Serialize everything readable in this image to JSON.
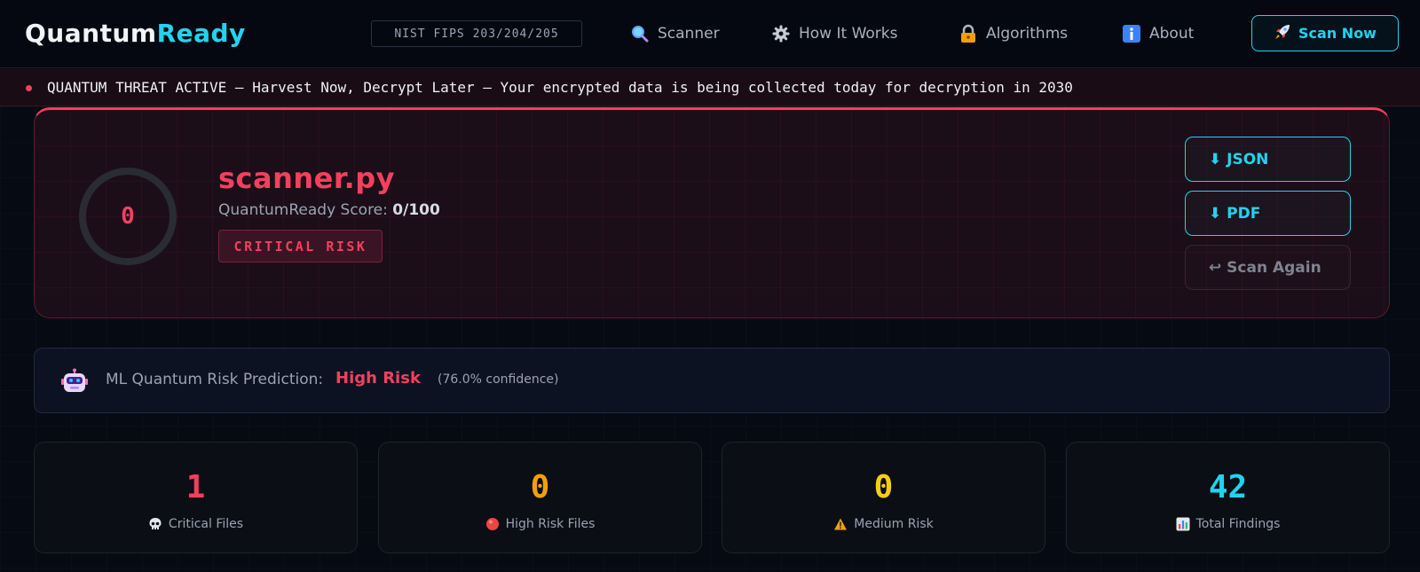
{
  "header": {
    "logo_part1": "Quantum",
    "logo_part2": "Ready",
    "badge": "NIST FIPS 203/204/205",
    "nav": [
      {
        "label": "Scanner",
        "icon": "magnifier-icon"
      },
      {
        "label": "How It Works",
        "icon": "gear-icon"
      },
      {
        "label": "Algorithms",
        "icon": "lock-icon"
      },
      {
        "label": "About",
        "icon": "info-icon"
      }
    ],
    "cta_label": "Scan Now",
    "cta_icon": "rocket-icon"
  },
  "alert": {
    "text": "QUANTUM THREAT ACTIVE — Harvest Now, Decrypt Later — Your encrypted data is being collected today for decryption in 2030"
  },
  "result": {
    "score": "0",
    "file_name": "scanner.py",
    "score_prefix": "QuantumReady Score: ",
    "score_text": "0/100",
    "risk_level": "CRITICAL RISK",
    "actions": {
      "json": "⬇ JSON",
      "pdf": "⬇ PDF",
      "scan_again": "↩ Scan Again"
    }
  },
  "ml": {
    "label": "ML Quantum Risk Prediction:",
    "prediction": "High Risk",
    "confidence": "(76.0% confidence)"
  },
  "stats": [
    {
      "value": "1",
      "label": "Critical Files",
      "icon": "skull-icon",
      "color": "#f43f5e"
    },
    {
      "value": "0",
      "label": "High Risk Files",
      "icon": "red-circle-icon",
      "color": "#f59e0b"
    },
    {
      "value": "0",
      "label": "Medium Risk",
      "icon": "warning-icon",
      "color": "#facc15"
    },
    {
      "value": "42",
      "label": "Total Findings",
      "icon": "bar-chart-icon",
      "color": "#22d3ee"
    }
  ],
  "colors": {
    "accent": "#22d3ee",
    "critical": "#f43f5e",
    "background": "#060a12"
  }
}
